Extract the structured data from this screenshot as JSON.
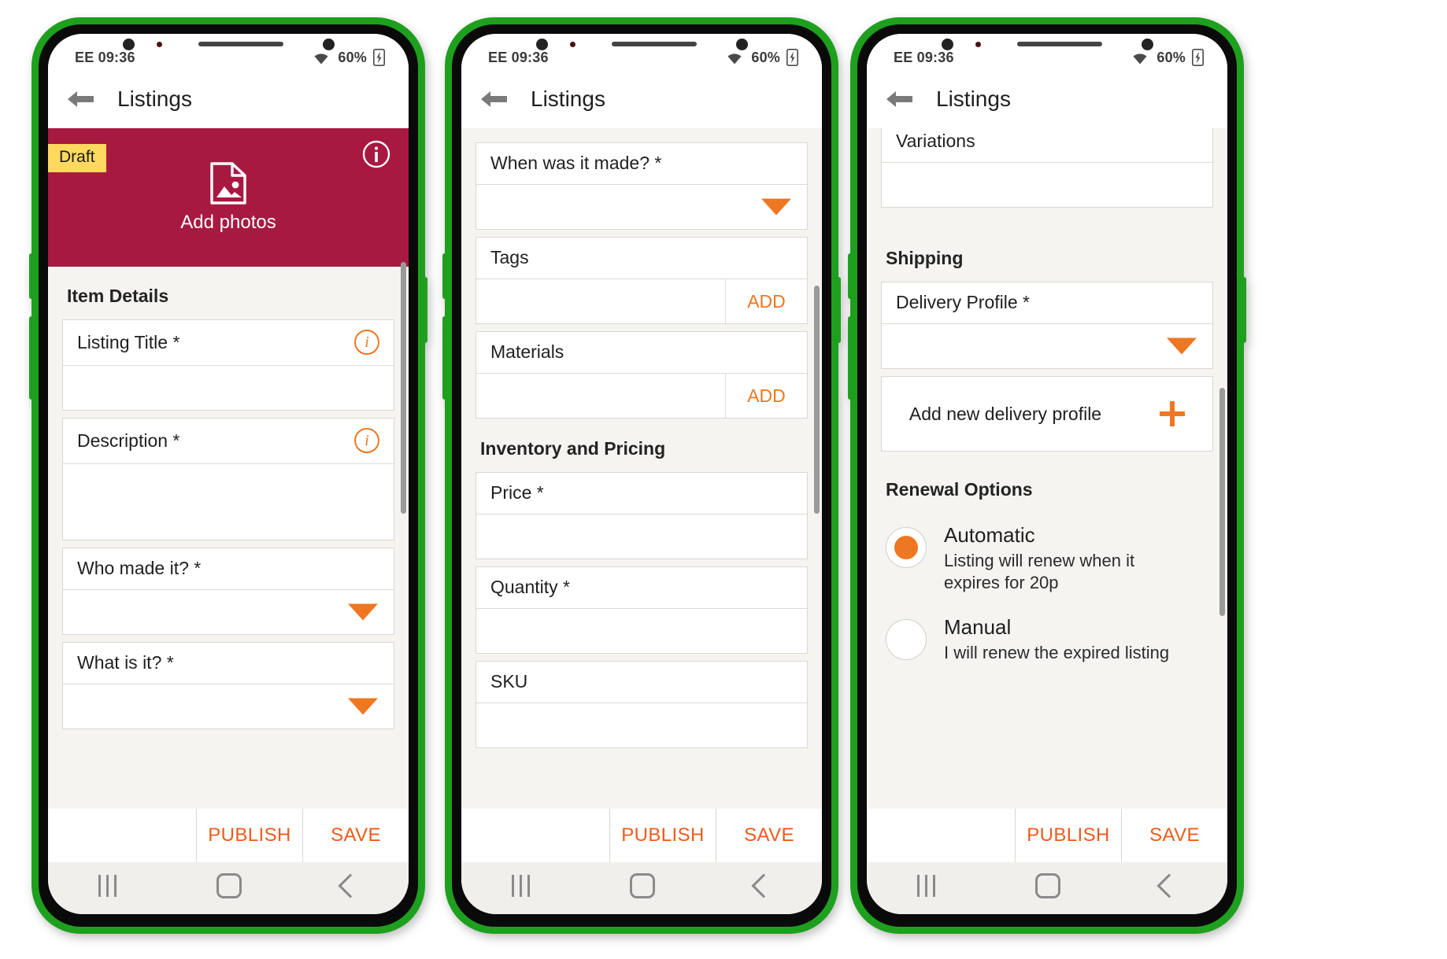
{
  "app": {
    "title": "Listings",
    "status": {
      "carrier_time": "EE 09:36",
      "battery": "60%",
      "wifi_icon": "wifi-icon",
      "battery_icon": "battery-icon"
    },
    "back_icon": "back-arrow-icon",
    "actions": {
      "publish": "PUBLISH",
      "save": "SAVE"
    },
    "nav": {
      "recents_icon": "recents-icon",
      "home_icon": "home-icon",
      "back_icon": "back-icon"
    },
    "colors": {
      "accent_orange": "#ee7722",
      "action_orange": "#ee5a1c",
      "hero_maroon": "#a81941",
      "draft_yellow": "#ffd95e",
      "phone_green": "#1ea01e",
      "screen_bg": "#f5f4f0"
    }
  },
  "screen1": {
    "hero": {
      "badge": "Draft",
      "info_icon": "info-icon",
      "photo_icon": "image-placeholder-icon",
      "add_photos_label": "Add photos"
    },
    "section_title": "Item Details",
    "fields": [
      {
        "label": "Listing Title *",
        "trailing": "info",
        "input": "text"
      },
      {
        "label": "Description *",
        "trailing": "info",
        "input": "textarea"
      },
      {
        "label": "Who made it? *",
        "trailing": "none",
        "input": "dropdown"
      },
      {
        "label": "What is it? *",
        "trailing": "none",
        "input": "dropdown"
      }
    ]
  },
  "screen2": {
    "fields_top": [
      {
        "label": "When was it made? *",
        "input": "dropdown"
      },
      {
        "label": "Tags",
        "input": "text_with_add",
        "add_label": "ADD"
      },
      {
        "label": "Materials",
        "input": "text_with_add",
        "add_label": "ADD"
      }
    ],
    "section_title": "Inventory and Pricing",
    "fields_bottom": [
      {
        "label": "Price *",
        "input": "text"
      },
      {
        "label": "Quantity *",
        "input": "text"
      },
      {
        "label": "SKU",
        "input": "text"
      }
    ]
  },
  "screen3": {
    "variations_label": "Variations",
    "shipping_title": "Shipping",
    "delivery_profile_label": "Delivery Profile *",
    "add_new_delivery_profile": "Add new delivery profile",
    "plus_icon": "plus-icon",
    "renewal_title": "Renewal Options",
    "renewal_options": [
      {
        "selected": true,
        "title": "Automatic",
        "subtitle": "Listing will renew when it expires for 20p"
      },
      {
        "selected": false,
        "title": "Manual",
        "subtitle": "I will renew the expired listing"
      }
    ]
  }
}
